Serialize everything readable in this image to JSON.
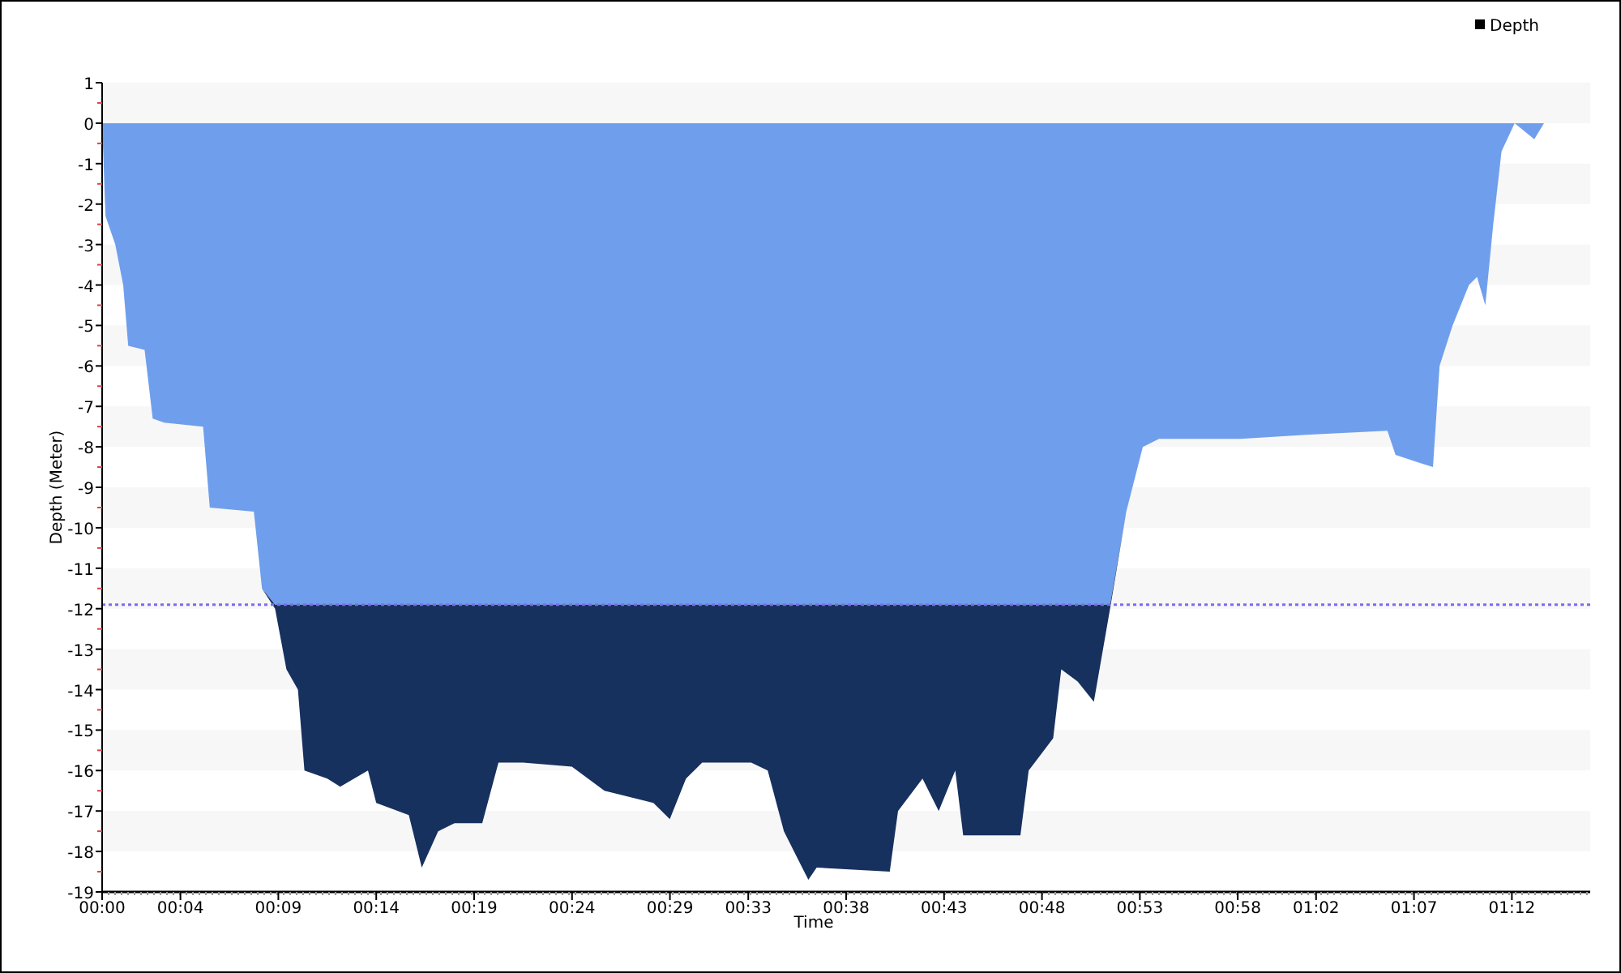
{
  "chart_data": {
    "type": "area",
    "xlabel": "Time",
    "ylabel": "Depth (Meter)",
    "xlim": [
      0,
      76
    ],
    "ylim": [
      -19,
      1
    ],
    "stacked": true,
    "series": [
      {
        "name": "Depth",
        "color": "#6f9fec",
        "values": [
          0,
          -2.3,
          -3,
          -4,
          -5.5,
          -5.6,
          -7.3,
          -7.4,
          -7.5,
          -9.5,
          -9.6,
          -11.5,
          -11.9,
          -11.9,
          -11.9,
          -11.9,
          -11.9,
          -11.9,
          -11.9,
          -11.9,
          -11.9,
          -11.9,
          -11.9,
          -11.9,
          -11.9,
          -11.9,
          -11.9,
          -11.9,
          -11.9,
          -11.9,
          -11.9,
          -11.9,
          -11.9,
          -11.9,
          -11.9,
          -11.9,
          -11.9,
          -11.9,
          -11.9,
          -11.9,
          -11.9,
          -11.9,
          -11.9,
          -11.9,
          -11.9,
          -11.9,
          -11.9,
          -11.9,
          -11.9,
          -11.9,
          -11.9,
          -11.9,
          -9.6,
          -8,
          -7.8,
          -7.8,
          -7.7,
          -7.6,
          -8.2,
          -8.4,
          -8.5,
          -6,
          -5,
          -4,
          -3.8,
          -4.5,
          -2.5,
          -0.7,
          0,
          -0.4,
          0
        ]
      },
      {
        "color": "#17315f",
        "values": [
          0,
          0,
          0,
          0,
          0,
          0,
          0,
          0,
          0,
          0,
          0,
          0,
          -0.1,
          -1.6,
          -2.1,
          -4.1,
          -4.3,
          -4.5,
          -4.1,
          -4.9,
          -5.2,
          -6.5,
          -5.6,
          -5.4,
          -5.4,
          -3.9,
          -3.9,
          -4,
          -4.6,
          -4.9,
          -5.3,
          -4.3,
          -3.9,
          -3.9,
          -4.1,
          -5.6,
          -6.4,
          -6.8,
          -6.5,
          -6.6,
          -5.1,
          -4.3,
          -5.1,
          -4.1,
          -5.7,
          -5.7,
          -4.1,
          -3.3,
          -1.6,
          -1.9,
          -2.4,
          -0.1,
          0,
          0,
          0,
          0,
          0,
          0,
          0,
          0,
          0,
          0,
          0,
          0,
          0,
          0,
          0,
          0,
          0,
          0,
          0
        ]
      }
    ],
    "x": [
      0,
      0.17,
      0.67,
      1.08,
      1.33,
      2.17,
      2.58,
      3.17,
      5.16,
      5.5,
      7.75,
      8.16,
      8.83,
      9.41,
      10.0,
      10.33,
      11.5,
      12.16,
      13.58,
      14.0,
      15.66,
      16.33,
      17.16,
      18.0,
      19.41,
      20.24,
      21.49,
      23.99,
      25.66,
      28.16,
      28.99,
      29.82,
      30.65,
      33.15,
      33.99,
      34.82,
      35.65,
      36.07,
      36.49,
      40.23,
      40.65,
      41.9,
      42.73,
      43.57,
      43.98,
      46.9,
      47.32,
      48.57,
      48.99,
      49.82,
      50.65,
      51.48,
      52.31,
      53.15,
      53.98,
      58.14,
      61.48,
      65.64,
      66.06,
      67.31,
      67.97,
      68.31,
      68.97,
      69.81,
      70.22,
      70.64,
      71.05,
      71.47,
      72.14,
      73.14,
      73.64
    ],
    "xticks": [
      {
        "value": 0,
        "label": "00:00"
      },
      {
        "value": 4,
        "label": "00:04"
      },
      {
        "value": 9,
        "label": "00:09"
      },
      {
        "value": 14,
        "label": "00:14"
      },
      {
        "value": 19,
        "label": "00:19"
      },
      {
        "value": 24,
        "label": "00:24"
      },
      {
        "value": 29,
        "label": "00:29"
      },
      {
        "value": 33,
        "label": "00:33"
      },
      {
        "value": 38,
        "label": "00:38"
      },
      {
        "value": 43,
        "label": "00:43"
      },
      {
        "value": 48,
        "label": "00:48"
      },
      {
        "value": 53,
        "label": "00:53"
      },
      {
        "value": 58,
        "label": "00:58"
      },
      {
        "value": 62,
        "label": "01:02"
      },
      {
        "value": 67,
        "label": "01:07"
      },
      {
        "value": 72,
        "label": "01:12"
      }
    ],
    "yticks": [
      1,
      0,
      -1,
      -2,
      -3,
      -4,
      -5,
      -6,
      -7,
      -8,
      -9,
      -10,
      -11,
      -12,
      -13,
      -14,
      -15,
      -16,
      -17,
      -18,
      -19
    ],
    "ref_lines": [
      {
        "axis": "y",
        "value": -11.9
      }
    ]
  }
}
